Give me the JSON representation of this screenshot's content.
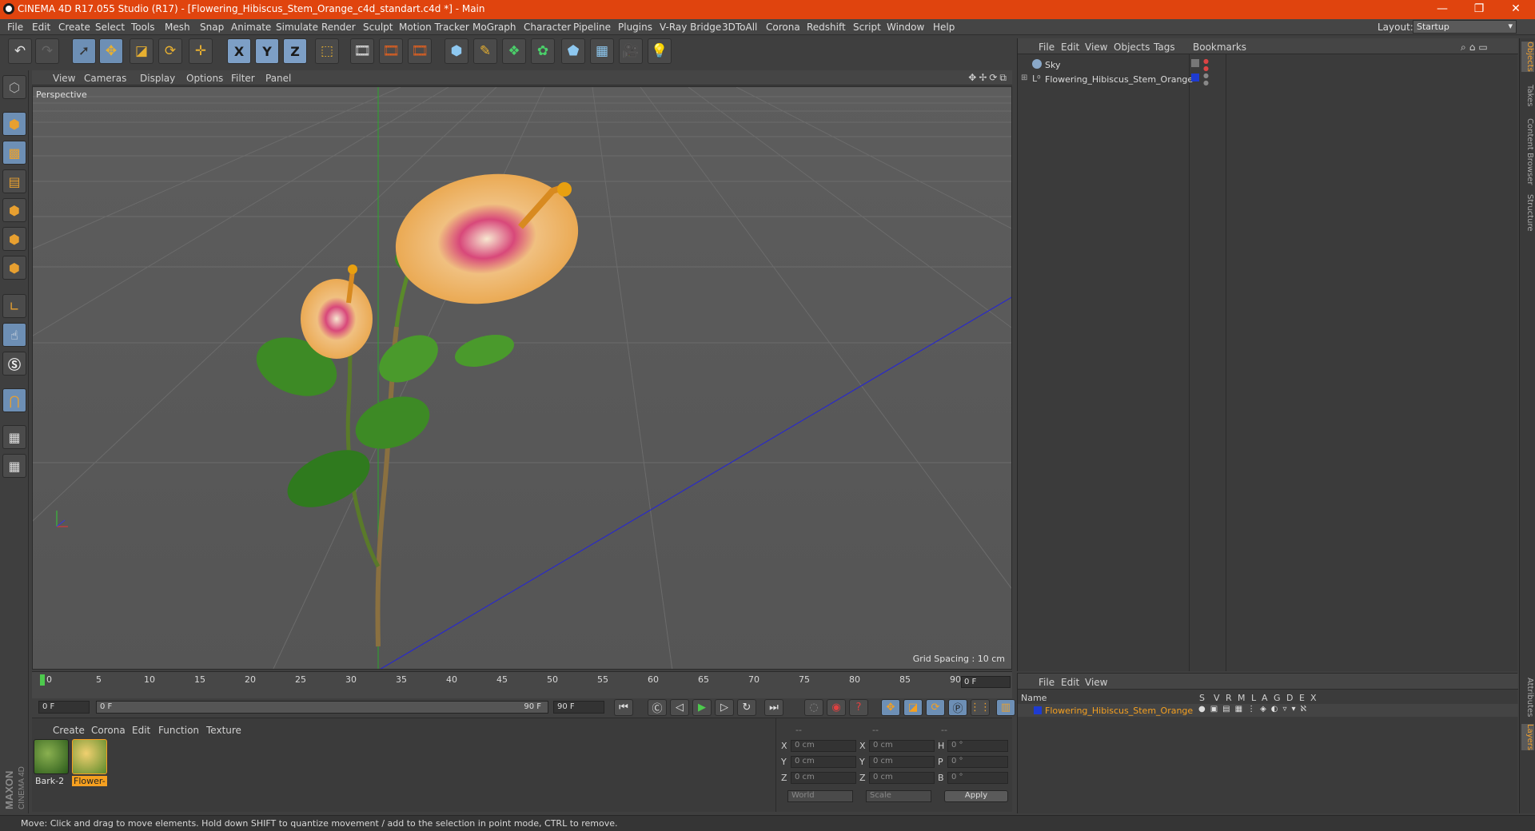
{
  "titlebar": {
    "title": "CINEMA 4D R17.055 Studio (R17) - [Flowering_Hibiscus_Stem_Orange_c4d_standart.c4d *] - Main",
    "min": "—",
    "restore": "❐",
    "close": "✕"
  },
  "menu": [
    "File",
    "Edit",
    "Create",
    "Select",
    "Tools",
    "Mesh",
    "Snap",
    "Animate",
    "Simulate",
    "Render",
    "Sculpt",
    "Motion Tracker",
    "MoGraph",
    "Character",
    "Pipeline",
    "Plugins",
    "V-Ray Bridge",
    "3DToAll",
    "Corona",
    "Redshift",
    "Script",
    "Window",
    "Help"
  ],
  "layout": {
    "label": "Layout:",
    "value": "Startup"
  },
  "viewport": {
    "menu": [
      "View",
      "Cameras",
      "Display",
      "Options",
      "Filter",
      "Panel"
    ],
    "label": "Perspective",
    "grid_spacing": "Grid Spacing : 10 cm",
    "nav_icons": "✥✢⟳⧉"
  },
  "timeline": {
    "ticks": [
      "0",
      "5",
      "10",
      "15",
      "20",
      "25",
      "30",
      "35",
      "40",
      "45",
      "50",
      "55",
      "60",
      "65",
      "70",
      "75",
      "80",
      "85",
      "90"
    ],
    "current_frame": "0 F"
  },
  "playbar": {
    "start": "0 F",
    "range_start": "0 F",
    "range_end": "90 F",
    "end": "90 F"
  },
  "materials": {
    "menu": [
      "Create",
      "Corona",
      "Edit",
      "Function",
      "Texture"
    ],
    "items": [
      {
        "name": "Bark-2"
      },
      {
        "name": "Flower-"
      }
    ]
  },
  "coords": {
    "headers": [
      "--",
      "--",
      "--"
    ],
    "rows": [
      {
        "a": "X",
        "v1": "0 cm",
        "b": "X",
        "v2": "0 cm",
        "c": "H",
        "v3": "0 °"
      },
      {
        "a": "Y",
        "v1": "0 cm",
        "b": "Y",
        "v2": "0 cm",
        "c": "P",
        "v3": "0 °"
      },
      {
        "a": "Z",
        "v1": "0 cm",
        "b": "Z",
        "v2": "0 cm",
        "c": "B",
        "v3": "0 °"
      }
    ],
    "world": "World",
    "scale": "Scale",
    "apply": "Apply"
  },
  "objects": {
    "menu": [
      "File",
      "Edit",
      "View",
      "Objects",
      "Tags",
      "Bookmarks"
    ],
    "items": [
      {
        "name": "Sky"
      },
      {
        "name": "Flowering_Hibiscus_Stem_Orange"
      }
    ]
  },
  "layers": {
    "menu": [
      "File",
      "Edit",
      "View"
    ],
    "name_header": "Name",
    "flag_headers": [
      "S",
      "V",
      "R",
      "M",
      "L",
      "A",
      "G",
      "D",
      "E",
      "X"
    ],
    "items": [
      {
        "name": "Flowering_Hibiscus_Stem_Orange"
      }
    ]
  },
  "sidetabs": [
    "Objects",
    "Takes",
    "Content Browser",
    "Structure",
    "Attributes",
    "Layers"
  ],
  "status": "Move: Click and drag to move elements. Hold down SHIFT to quantize movement / add to the selection in point mode, CTRL to remove.",
  "brand": {
    "maxon": "MAXON",
    "c4d": "CINEMA 4D"
  },
  "colors": {
    "title": "#e0440e",
    "selected": "#6d8fb5",
    "accent": "#f5a020",
    "layer": "#1e3bd1"
  }
}
